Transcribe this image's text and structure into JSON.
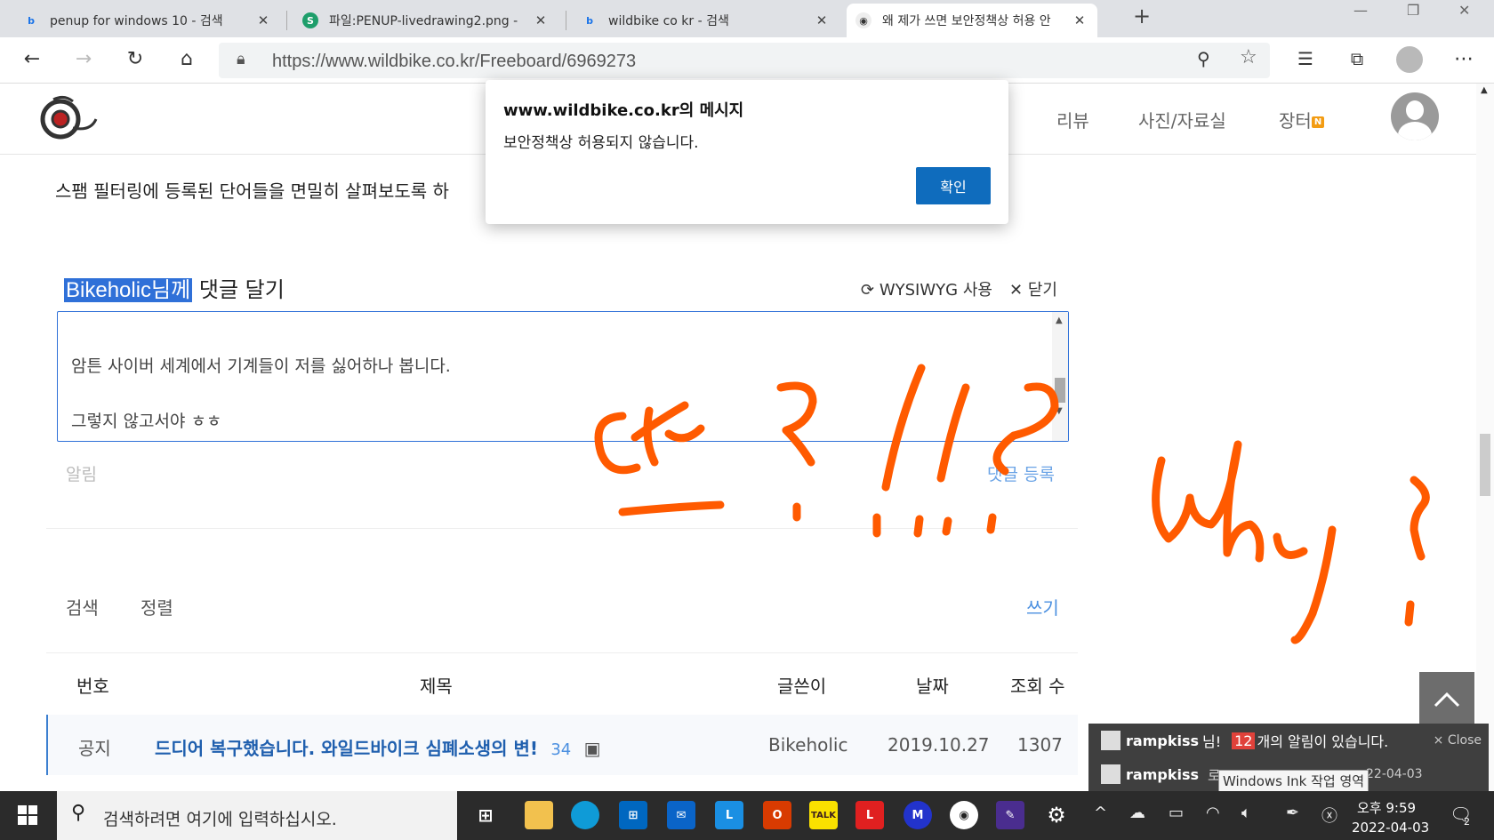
{
  "browser": {
    "tabs": [
      {
        "title": "penup for windows 10 - 검색",
        "favicon": "bing-icon"
      },
      {
        "title": "파일:PENUP-livedrawing2.png - ",
        "favicon": "wiki-icon"
      },
      {
        "title": "wildbike co kr - 검색",
        "favicon": "bing-icon"
      },
      {
        "title": "왜 제가 쓰면 보안정책상 허용 안",
        "favicon": "wildbike-icon"
      }
    ],
    "url": "https://www.wildbike.co.kr/Freeboard/6969273"
  },
  "site": {
    "nav": [
      "리뷰",
      "사진/자료실",
      "장터"
    ],
    "new_badge": "N"
  },
  "content": {
    "spam_text": "스팸 필터링에 등록된 단어들을 면밀히 살펴보도록 하",
    "comment_user": "Bikeholic님께",
    "comment_label": "댓글 달기",
    "wysiwyg": "WYSIWYG 사용",
    "close": "닫기",
    "editor_lines": [
      "암튼 사이버 세계에서 기계들이 저를 싫어하나 봅니다.",
      "그렇지 않고서야 ㅎㅎ"
    ],
    "notify_label": "알림",
    "submit_label": "댓글 등록",
    "search_tab": "검색",
    "sort_tab": "정렬",
    "write_link": "쓰기"
  },
  "table": {
    "headers": [
      "번호",
      "제목",
      "글쓴이",
      "날짜",
      "조회 수"
    ],
    "notice": {
      "num": "공지",
      "title": "드디어 복구했습니다. 와일드바이크 심폐소생의 변!",
      "comments": "34",
      "author": "Bikeholic",
      "date": "2019.10.27",
      "views": "1307"
    }
  },
  "alert": {
    "title": "www.wildbike.co.kr의 메시지",
    "message": "보안정책상 허용되지 않습니다.",
    "ok": "확인"
  },
  "notification": {
    "user": "rampkiss",
    "suffix": "님!",
    "count": "12",
    "message": "개의 알림이 있습니다.",
    "close": "× Close",
    "row2_user": "rampkiss",
    "row2_text": "로",
    "row2_date": "22-04-03",
    "ink_tooltip": "Windows Ink 작업 영역"
  },
  "taskbar": {
    "search_placeholder": "검색하려면 여기에 입력하십시오.",
    "time": "오후 9:59",
    "date": "2022-04-03",
    "notif_count": "2"
  },
  "colors": {
    "accent": "#2f70d8",
    "ink": "#ff5a00",
    "alert_button": "#0f6cbd"
  }
}
